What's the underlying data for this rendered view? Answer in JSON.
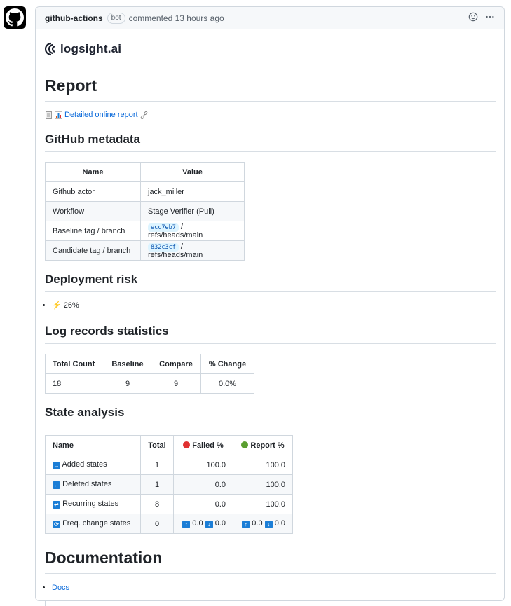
{
  "comment": {
    "author": "github-actions",
    "badge": "bot",
    "meta": "commented 13 hours ago"
  },
  "logo": {
    "text": "logsight.ai"
  },
  "report": {
    "title": "Report",
    "link_label": "Detailed online report"
  },
  "github_metadata": {
    "title": "GitHub metadata",
    "headers": [
      "Name",
      "Value"
    ],
    "rows": [
      {
        "name": "Github actor",
        "value": "jack_miller"
      },
      {
        "name": "Workflow",
        "value": "Stage Verifier (Pull)"
      },
      {
        "name": "Baseline tag / branch",
        "tag": "ecc7eb7",
        "branch": "/ refs/heads/main"
      },
      {
        "name": "Candidate tag / branch",
        "tag": "832c3cf",
        "branch": "/ refs/heads/main"
      }
    ]
  },
  "deployment_risk": {
    "title": "Deployment risk",
    "value": "26%"
  },
  "log_stats": {
    "title": "Log records statistics",
    "headers": [
      "Total Count",
      "Baseline",
      "Compare",
      "% Change"
    ],
    "row": [
      "18",
      "9",
      "9",
      "0.0%"
    ]
  },
  "state_analysis": {
    "title": "State analysis",
    "headers": [
      "Name",
      "Total",
      "Failed %",
      "Report %"
    ],
    "rows": [
      {
        "name": "Added states",
        "total": "1",
        "failed": "100.0",
        "report": "100.0"
      },
      {
        "name": "Deleted states",
        "total": "1",
        "failed": "0.0",
        "report": "100.0"
      },
      {
        "name": "Recurring states",
        "total": "8",
        "failed": "0.0",
        "report": "100.0"
      }
    ],
    "freq_row": {
      "name": "Freq. change states",
      "total": "0",
      "failed_up": "0.0",
      "failed_down": "0.0",
      "report_up": "0.0",
      "report_down": "0.0"
    }
  },
  "documentation": {
    "title": "Documentation",
    "link_label": "Docs"
  },
  "colors": {
    "link": "#0969da",
    "failed_dot": "#e03131",
    "report_dot": "#5a9e2f",
    "arrow_box": "#1c7ed6"
  }
}
